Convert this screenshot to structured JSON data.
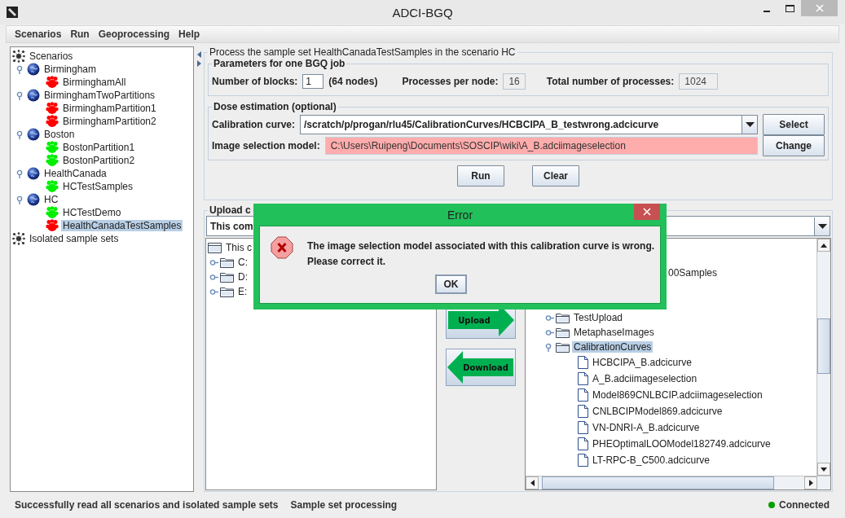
{
  "window": {
    "title": "ADCI-BGQ"
  },
  "menu": [
    "Scenarios",
    "Run",
    "Geoprocessing",
    "Help"
  ],
  "scenario_tree": {
    "roots": [
      {
        "label": "Scenarios",
        "children": [
          {
            "label": "Birmingham",
            "expanded": true,
            "children": [
              {
                "label": "BirminghamAll",
                "color": "#ff0000",
                "selected": false
              }
            ]
          },
          {
            "label": "BirminghamTwoPartitions",
            "expanded": true,
            "children": [
              {
                "label": "BirminghamPartition1",
                "color": "#ff0000",
                "selected": false
              },
              {
                "label": "BirminghamPartition2",
                "color": "#ff0000",
                "selected": false
              }
            ]
          },
          {
            "label": "Boston",
            "expanded": true,
            "children": [
              {
                "label": "BostonPartition1",
                "color": "#00ee00",
                "selected": false
              },
              {
                "label": "BostonPartition2",
                "color": "#00ee00",
                "selected": false
              }
            ]
          },
          {
            "label": "HealthCanada",
            "expanded": true,
            "children": [
              {
                "label": "HCTestSamples",
                "color": "#00ee00",
                "selected": false
              }
            ]
          },
          {
            "label": "HC",
            "expanded": true,
            "children": [
              {
                "label": "HCTestDemo",
                "color": "#00ee00",
                "selected": false
              },
              {
                "label": "HealthCanadaTestSamples",
                "color": "#ff0000",
                "selected": true
              }
            ]
          }
        ]
      },
      {
        "label": "Isolated sample sets"
      }
    ]
  },
  "process": {
    "title": "Process the sample set HealthCanadaTestSamples in the scenario HC",
    "parameters": {
      "title": "Parameters for one BGQ job",
      "blocks_label": "Number of blocks:",
      "blocks_value": "1",
      "nodes_note": "(64 nodes)",
      "ppn_label": "Processes per node:",
      "ppn_value": "16",
      "total_label": "Total number of processes:",
      "total_value": "1024"
    },
    "dose": {
      "title": "Dose estimation (optional)",
      "curve_label": "Calibration curve:",
      "curve_value": "/scratch/p/progan/rlu45/CalibrationCurves/HCBCIPA_B_testwrong.adcicurve",
      "select_button": "Select",
      "model_label": "Image selection model:",
      "model_value": "C:\\Users\\Ruipeng\\Documents\\SOSCIP\\wiki\\A_B.adciimageselection",
      "model_invalid": true,
      "change_button": "Change"
    },
    "buttons": [
      "Run",
      "Clear"
    ]
  },
  "upload": {
    "title": "Upload c",
    "source": "This com",
    "local_tree": {
      "items": [
        {
          "label": "This c",
          "children": [
            {
              "label": "C:",
              "expanded": false
            },
            {
              "label": "D:",
              "expanded": false
            },
            {
              "label": "E:",
              "expanded": false
            }
          ]
        }
      ]
    },
    "upload_button": "Upload",
    "download_button": "Download",
    "remote_tree": {
      "items": [
        {
          "kind": "clipped",
          "label": "00Samples"
        },
        {
          "kind": "folder",
          "label": "TestUpload",
          "expanded": false,
          "selected": false
        },
        {
          "kind": "folder",
          "label": "MetaphaseImages",
          "expanded": false,
          "selected": false
        },
        {
          "kind": "folder",
          "label": "CalibrationCurves",
          "expanded": true,
          "selected": true,
          "children": [
            {
              "kind": "file",
              "label": "HCBCIPA_B.adcicurve"
            },
            {
              "kind": "file",
              "label": "A_B.adciimageselection"
            },
            {
              "kind": "file",
              "label": "Model869CNLBCIP.adciimageselection"
            },
            {
              "kind": "file",
              "label": "CNLBCIPModel869.adcicurve"
            },
            {
              "kind": "file",
              "label": "VN-DNRI-A_B.adcicurve"
            },
            {
              "kind": "file",
              "label": "PHEOptimalLOOModel182749.adcicurve"
            },
            {
              "kind": "file",
              "label": "LT-RPC-B_C500.adcicurve"
            }
          ]
        }
      ]
    }
  },
  "dialog": {
    "title": "Error",
    "message": [
      "The image selection model associated with this calibration curve is wrong.",
      "Please correct it."
    ],
    "ok_button": "OK"
  },
  "status_bar": {
    "message": "Successfully read all scenarios and isolated sample sets",
    "mode": "Sample set processing",
    "connection": "Connected",
    "connected": true
  }
}
